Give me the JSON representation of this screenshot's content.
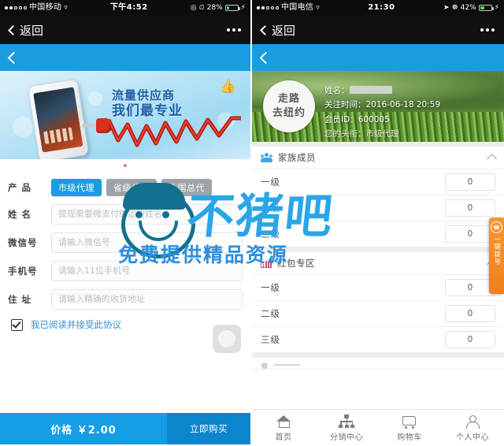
{
  "left_phone": {
    "status_bar": {
      "signal_dots": "●●○○○",
      "carrier": "中国移动",
      "wifi_icon": "wifi-icon",
      "time": "下午4:52",
      "battery_percent": "28%",
      "battery_level": 28,
      "icons": [
        "location-icon",
        "alarm-icon",
        "charging-icon"
      ]
    },
    "wechat_nav": {
      "back_label": "返回",
      "back_icon": "chevron-left-icon",
      "menu_icon": "more-dots-icon"
    },
    "app_bar": {
      "back_icon": "chevron-left-icon"
    },
    "banner": {
      "line1": "流量供应商",
      "line2": "我们最专业",
      "thumb_icon": "thumbs-up-icon",
      "carousel_dots": 1
    },
    "form": {
      "product": {
        "label": "产 品",
        "options": [
          {
            "label": "市级代理",
            "selected": true
          },
          {
            "label": "省级代理",
            "selected": false
          },
          {
            "label": "全国总代",
            "selected": false
          }
        ]
      },
      "fields": [
        {
          "label": "姓 名",
          "name": "name-field",
          "value": "",
          "placeholder": "提现需要微支付绑定的姓名"
        },
        {
          "label": "微信号",
          "name": "wechat-id-field",
          "value": "",
          "placeholder": "请输入微信号"
        },
        {
          "label": "手机号",
          "name": "phone-field",
          "value": "",
          "placeholder": "请输入11位手机号"
        },
        {
          "label": "住 址",
          "name": "address-field",
          "value": "",
          "placeholder": "请输入精确的收货地址"
        }
      ],
      "agreement": {
        "checked": true,
        "label": "我已阅读并接受此协议"
      }
    },
    "buy_bar": {
      "price_label": "价格 ￥2.00",
      "buy_label": "立即购买",
      "price_bg": "#159ee6",
      "buy_bg": "#0b86cd"
    }
  },
  "right_phone": {
    "status_bar": {
      "signal_dots": "●●○○○",
      "carrier": "中国电信",
      "wifi_icon": "wifi-icon",
      "time": "21:30",
      "battery_percent": "42%",
      "battery_level": 42,
      "icons": [
        "location-icon",
        "bluetooth-icon",
        "charging-icon"
      ]
    },
    "wechat_nav": {
      "back_label": "返回",
      "back_icon": "chevron-left-icon",
      "menu_icon": "more-dots-icon"
    },
    "app_bar": {
      "back_icon": "chevron-left-icon"
    },
    "profile": {
      "avatar_line1": "走路",
      "avatar_line2": "去纽约",
      "name_label": "姓名：",
      "name_value": "",
      "follow_time_label": "关注时间：",
      "follow_time_value": "2016-06-18 20:59",
      "member_id_label": "会员ID：",
      "member_id_value": "600005",
      "title_label": "您的头衔：",
      "title_value": "市级代理"
    },
    "sections": [
      {
        "name": "family-members",
        "icon": "group-people-icon",
        "title": "家族成员",
        "collapse_icon": "chevron-up-icon",
        "rows": [
          {
            "label": "一级",
            "value": "0"
          },
          {
            "label": "二级",
            "value": "0"
          },
          {
            "label": "三级",
            "value": "0"
          }
        ]
      },
      {
        "name": "red-packet-zone",
        "icon": "bar-chart-icon",
        "title": "红包专区",
        "collapse_icon": "chevron-up-icon",
        "rows": [
          {
            "label": "一级",
            "value": "0"
          },
          {
            "label": "二级",
            "value": "0"
          },
          {
            "label": "三级",
            "value": "0"
          }
        ]
      }
    ],
    "floating_button": {
      "icon": "phone-ring-icon",
      "label": "一键拨号",
      "color": "#f0801c"
    },
    "tab_bar": [
      {
        "name": "tab-home",
        "icon": "home-icon",
        "label": "首页"
      },
      {
        "name": "tab-distribution",
        "icon": "network-tree-icon",
        "label": "分销中心"
      },
      {
        "name": "tab-cart",
        "icon": "shopping-cart-icon",
        "label": "购物车"
      },
      {
        "name": "tab-profile",
        "icon": "user-icon",
        "label": "个人中心"
      }
    ]
  },
  "watermark": {
    "brand": "不猪吧",
    "tagline": "免费提供精品资源",
    "face_icon": "cartoon-face-icon",
    "color": "#2aa6e8"
  }
}
